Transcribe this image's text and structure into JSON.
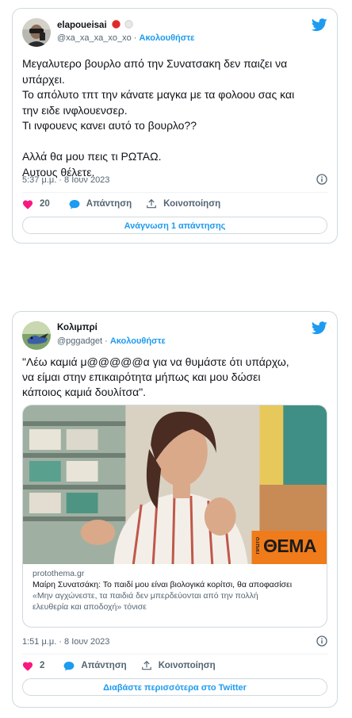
{
  "tweet1": {
    "display_name": "elapoueisai",
    "handle": "@xa_xa_xa_xo_xo",
    "separator": "·",
    "follow_label": "Ακολουθήστε",
    "text_lines": [
      "Μεγαλυτερο βουρλο από την Συνατσακη δεν παιζει να",
      "υπάρχει.",
      "Το απόλυτο τπτ την κάνατε μαγκα με τα φολοου σας και",
      "την ειδε ινφλουενσερ.",
      "Τι ινφουενς κανει αυτό το βουρλο??",
      "",
      "Αλλά θα μου πεις τι ΡΩΤΑΩ.",
      "Αυτους θέλετε."
    ],
    "timestamp": "5:37 μ.μ. · 8 Ιουν 2023",
    "like_count": "20",
    "reply_label": "Απάντηση",
    "share_label": "Κοινοποίηση",
    "footer_button": "Ανάγνωση 1 απάντησης"
  },
  "tweet2": {
    "display_name": "Κολιμπρί",
    "handle": "@pggadget",
    "separator": "·",
    "follow_label": "Ακολουθήστε",
    "text_lines": [
      "\"Λέω καμιά μ@@@@@α για να θυμάστε ότι υπάρχω,",
      "να είμαι στην επικαιρότητα μήπως και μου δώσει",
      "κάποιος καμιά δουλίτσα\"."
    ],
    "card": {
      "logo_text": "ΘΕΜΑ",
      "logo_small": "ΠΡΩΤΟ",
      "domain": "protothema.gr",
      "title": "Μαίρη Συνατσάκη: Το παιδί μου είναι βιολογικά κορίτσι, θα αποφασίσει",
      "description_lines": [
        "«Μην αγχώνεστε, τα παιδιά δεν μπερδεύονται από την πολλή",
        "ελευθερία και αποδοχή» τόνισε"
      ]
    },
    "timestamp": "1:51 μ.μ. · 8 Ιουν 2023",
    "like_count": "2",
    "reply_label": "Απάντηση",
    "share_label": "Κοινοποίηση",
    "footer_button": "Διαβάστε περισσότερα στο Twitter"
  },
  "colors": {
    "twitter_blue": "#1d9bf0",
    "like_red": "#f91880",
    "text_primary": "#0f1419",
    "text_secondary": "#536471",
    "border": "#cfd9de",
    "logo_orange": "#f07b1a"
  },
  "icons": [
    "twitter-bird-icon",
    "heart-icon",
    "reply-bubble-icon",
    "share-upload-icon",
    "info-icon",
    "verified-badge-icon"
  ]
}
